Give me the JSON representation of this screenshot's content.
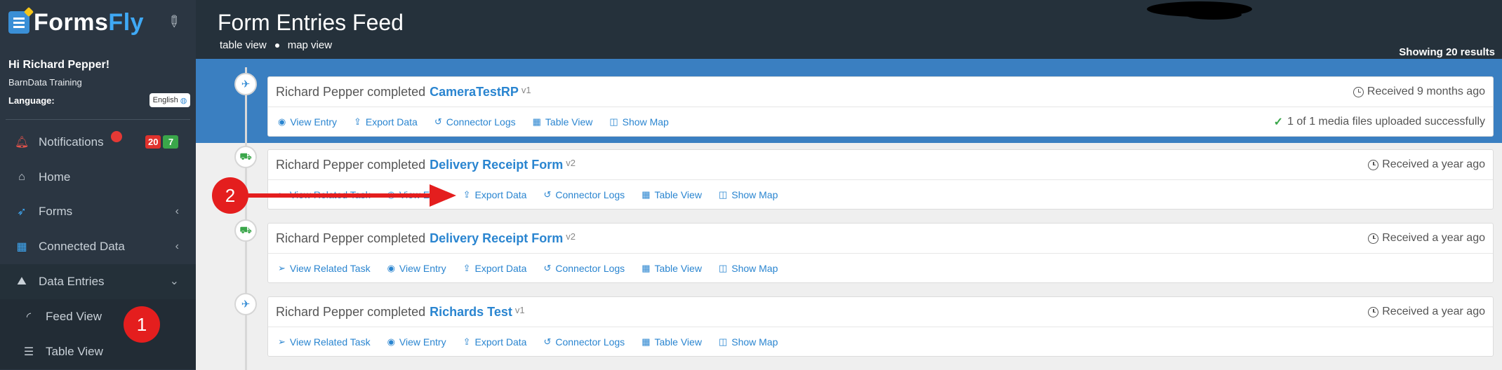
{
  "app": {
    "logo_part1": "Forms",
    "logo_part2": "Fly"
  },
  "sidebar": {
    "greeting": "Hi Richard Pepper!",
    "organization": "BarnData Training",
    "language_label": "Language:",
    "language_value": "English",
    "notifications": {
      "label": "Notifications",
      "count_red": "20",
      "count_green": "7"
    },
    "items": [
      {
        "label": "Home"
      },
      {
        "label": "Forms"
      },
      {
        "label": "Connected Data"
      },
      {
        "label": "Data Entries"
      }
    ],
    "subitems": [
      {
        "label": "Feed View"
      },
      {
        "label": "Table View"
      }
    ]
  },
  "header": {
    "title": "Form Entries Feed",
    "view_table": "table view",
    "view_map": "map view",
    "results": "Showing 20 results"
  },
  "entries": [
    {
      "user_text": "Richard Pepper completed",
      "form_name": "CameraTestRP",
      "version": "v1",
      "received": "Received 9 months ago",
      "actions": [
        "View Entry",
        "Export Data",
        "Connector Logs",
        "Table View",
        "Show Map"
      ],
      "media_status": "1 of 1 media files uploaded successfully"
    },
    {
      "user_text": "Richard Pepper completed",
      "form_name": "Delivery Receipt Form",
      "version": "v2",
      "received": "Received a year ago",
      "actions": [
        "View Related Task",
        "View Entry",
        "Export Data",
        "Connector Logs",
        "Table View",
        "Show Map"
      ]
    },
    {
      "user_text": "Richard Pepper completed",
      "form_name": "Delivery Receipt Form",
      "version": "v2",
      "received": "Received a year ago",
      "actions": [
        "View Related Task",
        "View Entry",
        "Export Data",
        "Connector Logs",
        "Table View",
        "Show Map"
      ]
    },
    {
      "user_text": "Richard Pepper completed",
      "form_name": "Richards Test",
      "version": "v1",
      "received": "Received a year ago",
      "actions": [
        "View Related Task",
        "View Entry",
        "Export Data",
        "Connector Logs",
        "Table View",
        "Show Map"
      ]
    }
  ],
  "annotations": {
    "marker1": "1",
    "marker2": "2"
  },
  "colors": {
    "sidebar_bg": "#2b3642",
    "header_bg": "#25313b",
    "accent_blue": "#2a85d0",
    "band_blue": "#3a7fc1",
    "annotation_red": "#e41e1e"
  }
}
